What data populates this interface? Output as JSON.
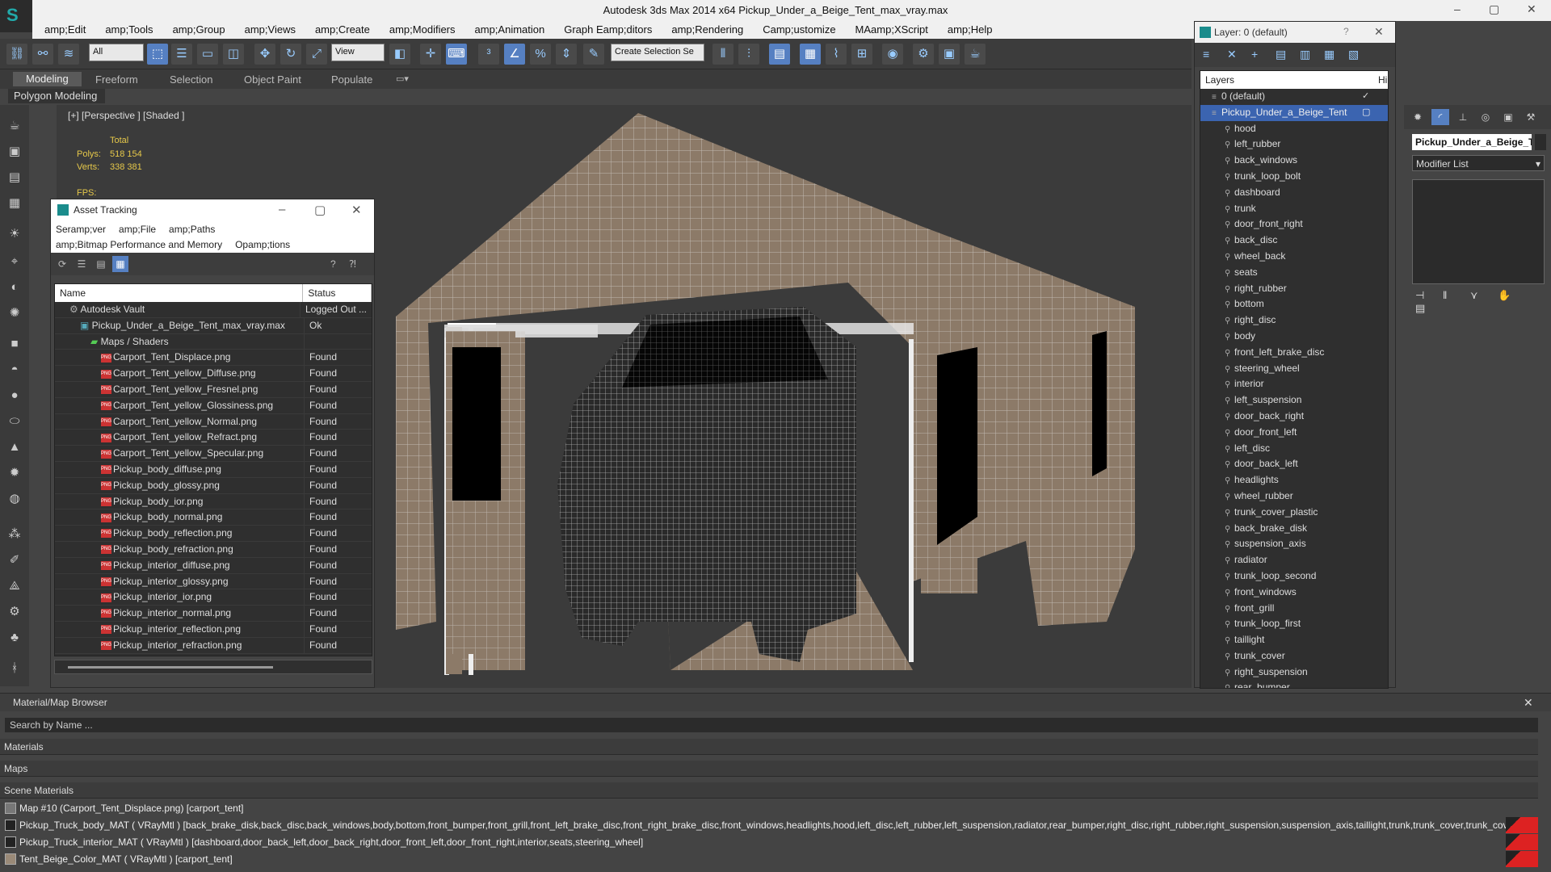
{
  "app": {
    "title": "Autodesk 3ds Max  2014 x64     Pickup_Under_a_Beige_Tent_max_vray.max",
    "logo": "3ds-max-logo"
  },
  "menu": [
    "amp;Edit",
    "amp;Tools",
    "amp;Group",
    "amp;Views",
    "amp;Create",
    "amp;Modifiers",
    "amp;Animation",
    "Graph Eamp;ditors",
    "amp;Rendering",
    "Camp;ustomize",
    "MAamp;XScript",
    "amp;Help"
  ],
  "toolbar": {
    "filter": "All",
    "refcoord": "View",
    "selset": "Create Selection Se"
  },
  "ribbon": {
    "tabs": [
      "Modeling",
      "Freeform",
      "Selection",
      "Object Paint",
      "Populate"
    ],
    "sub": "Polygon Modeling"
  },
  "viewport": {
    "label": "[+] [Perspective ] [Shaded ]",
    "total": "Total",
    "polys_label": "Polys:",
    "polys": "518 154",
    "verts_label": "Verts:",
    "verts": "338 381",
    "fps": "FPS:"
  },
  "asset": {
    "title": "Asset Tracking",
    "menu1": [
      "Seramp;ver",
      "amp;File",
      "amp;Paths"
    ],
    "menu2": [
      "amp;Bitmap Performance and Memory",
      "Opamp;tions"
    ],
    "col_name": "Name",
    "col_status": "Status",
    "rows": [
      {
        "name": "Autodesk Vault",
        "status": "Logged Out ...",
        "indent": 1,
        "icon": "vault"
      },
      {
        "name": "Pickup_Under_a_Beige_Tent_max_vray.max",
        "status": "Ok",
        "indent": 2,
        "icon": "max"
      },
      {
        "name": "Maps / Shaders",
        "status": "",
        "indent": 3,
        "icon": "maps"
      },
      {
        "name": "Carport_Tent_Displace.png",
        "status": "Found",
        "indent": 4,
        "icon": "png"
      },
      {
        "name": "Carport_Tent_yellow_Diffuse.png",
        "status": "Found",
        "indent": 4,
        "icon": "png"
      },
      {
        "name": "Carport_Tent_yellow_Fresnel.png",
        "status": "Found",
        "indent": 4,
        "icon": "png"
      },
      {
        "name": "Carport_Tent_yellow_Glossiness.png",
        "status": "Found",
        "indent": 4,
        "icon": "png"
      },
      {
        "name": "Carport_Tent_yellow_Normal.png",
        "status": "Found",
        "indent": 4,
        "icon": "png"
      },
      {
        "name": "Carport_Tent_yellow_Refract.png",
        "status": "Found",
        "indent": 4,
        "icon": "png"
      },
      {
        "name": "Carport_Tent_yellow_Specular.png",
        "status": "Found",
        "indent": 4,
        "icon": "png"
      },
      {
        "name": "Pickup_body_diffuse.png",
        "status": "Found",
        "indent": 4,
        "icon": "png"
      },
      {
        "name": "Pickup_body_glossy.png",
        "status": "Found",
        "indent": 4,
        "icon": "png"
      },
      {
        "name": "Pickup_body_ior.png",
        "status": "Found",
        "indent": 4,
        "icon": "png"
      },
      {
        "name": "Pickup_body_normal.png",
        "status": "Found",
        "indent": 4,
        "icon": "png"
      },
      {
        "name": "Pickup_body_reflection.png",
        "status": "Found",
        "indent": 4,
        "icon": "png"
      },
      {
        "name": "Pickup_body_refraction.png",
        "status": "Found",
        "indent": 4,
        "icon": "png"
      },
      {
        "name": "Pickup_interior_diffuse.png",
        "status": "Found",
        "indent": 4,
        "icon": "png"
      },
      {
        "name": "Pickup_interior_glossy.png",
        "status": "Found",
        "indent": 4,
        "icon": "png"
      },
      {
        "name": "Pickup_interior_ior.png",
        "status": "Found",
        "indent": 4,
        "icon": "png"
      },
      {
        "name": "Pickup_interior_normal.png",
        "status": "Found",
        "indent": 4,
        "icon": "png"
      },
      {
        "name": "Pickup_interior_reflection.png",
        "status": "Found",
        "indent": 4,
        "icon": "png"
      },
      {
        "name": "Pickup_interior_refraction.png",
        "status": "Found",
        "indent": 4,
        "icon": "png"
      }
    ]
  },
  "layer": {
    "title": "Layer: 0 (default)",
    "help": "?",
    "col": "Layers",
    "col2": "Hi",
    "items": [
      {
        "name": "0 (default)",
        "level": 0,
        "check": "✓"
      },
      {
        "name": "Pickup_Under_a_Beige_Tent",
        "level": 0,
        "selected": true,
        "check": "▢"
      },
      {
        "name": "hood",
        "level": 1
      },
      {
        "name": "left_rubber",
        "level": 1
      },
      {
        "name": "back_windows",
        "level": 1
      },
      {
        "name": "trunk_loop_bolt",
        "level": 1
      },
      {
        "name": "dashboard",
        "level": 1
      },
      {
        "name": "trunk",
        "level": 1
      },
      {
        "name": "door_front_right",
        "level": 1
      },
      {
        "name": "back_disc",
        "level": 1
      },
      {
        "name": "wheel_back",
        "level": 1
      },
      {
        "name": "seats",
        "level": 1
      },
      {
        "name": "right_rubber",
        "level": 1
      },
      {
        "name": "bottom",
        "level": 1
      },
      {
        "name": "right_disc",
        "level": 1
      },
      {
        "name": "body",
        "level": 1
      },
      {
        "name": "front_left_brake_disc",
        "level": 1
      },
      {
        "name": "steering_wheel",
        "level": 1
      },
      {
        "name": "interior",
        "level": 1
      },
      {
        "name": "left_suspension",
        "level": 1
      },
      {
        "name": "door_back_right",
        "level": 1
      },
      {
        "name": "door_front_left",
        "level": 1
      },
      {
        "name": "left_disc",
        "level": 1
      },
      {
        "name": "door_back_left",
        "level": 1
      },
      {
        "name": "headlights",
        "level": 1
      },
      {
        "name": "wheel_rubber",
        "level": 1
      },
      {
        "name": "trunk_cover_plastic",
        "level": 1
      },
      {
        "name": "back_brake_disk",
        "level": 1
      },
      {
        "name": "suspension_axis",
        "level": 1
      },
      {
        "name": "radiator",
        "level": 1
      },
      {
        "name": "trunk_loop_second",
        "level": 1
      },
      {
        "name": "front_windows",
        "level": 1
      },
      {
        "name": "front_grill",
        "level": 1
      },
      {
        "name": "trunk_loop_first",
        "level": 1
      },
      {
        "name": "taillight",
        "level": 1
      },
      {
        "name": "trunk_cover",
        "level": 1
      },
      {
        "name": "right_suspension",
        "level": 1
      },
      {
        "name": "rear_bumper",
        "level": 1
      }
    ]
  },
  "command": {
    "object_name": "Pickup_Under_a_Beige_T",
    "modifier_list": "Modifier List"
  },
  "matbrowser": {
    "title": "Material/Map Browser",
    "search": "Search by Name ...",
    "sections": [
      "Materials",
      "Maps",
      "Scene Materials"
    ],
    "rows": [
      "Map #10 (Carport_Tent_Displace.png) [carport_tent]",
      "Pickup_Truck_body_MAT ( VRayMtl ) [back_brake_disk,back_disc,back_windows,body,bottom,front_bumper,front_grill,front_left_brake_disc,front_right_brake_disc,front_windows,headlights,hood,left_disc,left_rubber,left_suspension,radiator,rear_bumper,right_disc,right_rubber,right_suspension,suspension_axis,taillight,trunk,trunk_cover,trunk_cover...",
      "Pickup_Truck_interior_MAT ( VRayMtl ) [dashboard,door_back_left,door_back_right,door_front_left,door_front_right,interior,seats,steering_wheel]",
      "Tent_Beige_Color_MAT ( VRayMtl ) [carport_tent]"
    ]
  },
  "colors": {
    "accent": "#5680c2",
    "tent": "#8c7a68",
    "wire": "#e8e8e8",
    "status_yellow": "#e6c84a"
  }
}
